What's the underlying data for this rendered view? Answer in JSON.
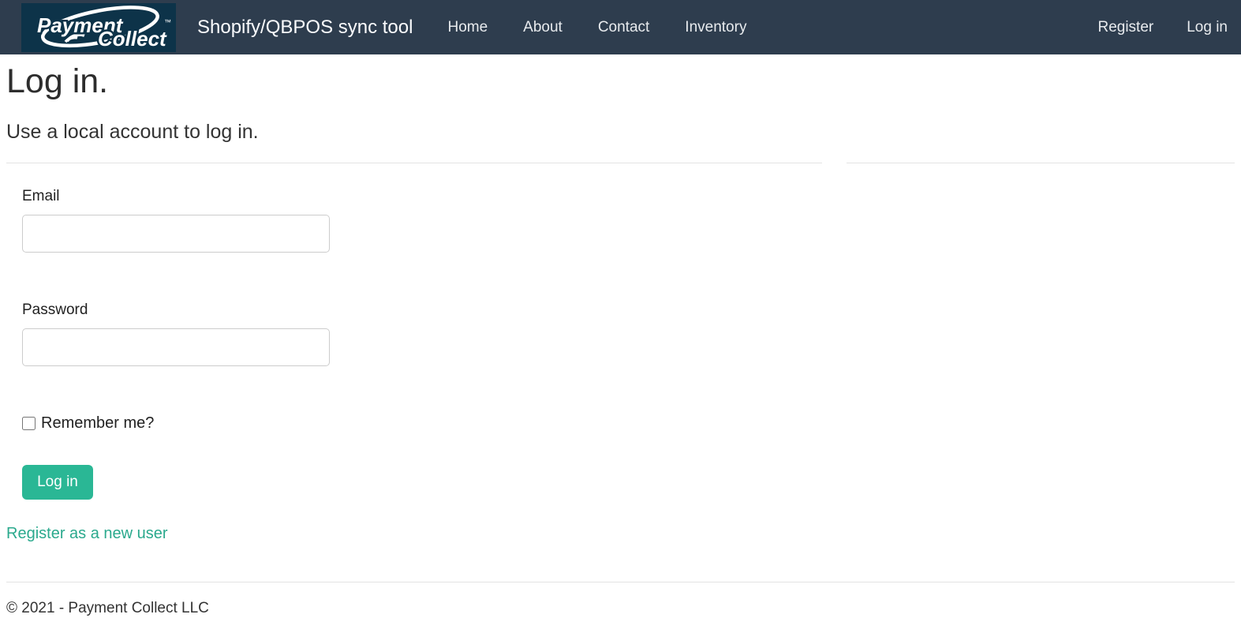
{
  "colors": {
    "navbar_bg": "#2e3d4e",
    "logo_bg": "#0d3349",
    "accent_green": "#2ab795",
    "link_teal": "#2aa98d",
    "divider": "#e3e3e3"
  },
  "navbar": {
    "logo": {
      "part1": "Payment",
      "part2": "Collect",
      "tm": "™"
    },
    "app_title": "Shopify/QBPOS sync tool",
    "items": [
      {
        "label": "Home"
      },
      {
        "label": "About"
      },
      {
        "label": "Contact"
      },
      {
        "label": "Inventory"
      }
    ],
    "account_items": [
      {
        "label": "Register"
      },
      {
        "label": "Log in"
      }
    ]
  },
  "main": {
    "title": "Log in.",
    "subtitle": "Use a local account to log in.",
    "form": {
      "email_label": "Email",
      "email_value": "",
      "password_label": "Password",
      "password_value": "",
      "remember_label": "Remember me?",
      "remember_checked": false,
      "submit_label": "Log in",
      "register_link_label": "Register as a new user"
    }
  },
  "footer": {
    "copyright": "© 2021 - Payment Collect LLC"
  }
}
